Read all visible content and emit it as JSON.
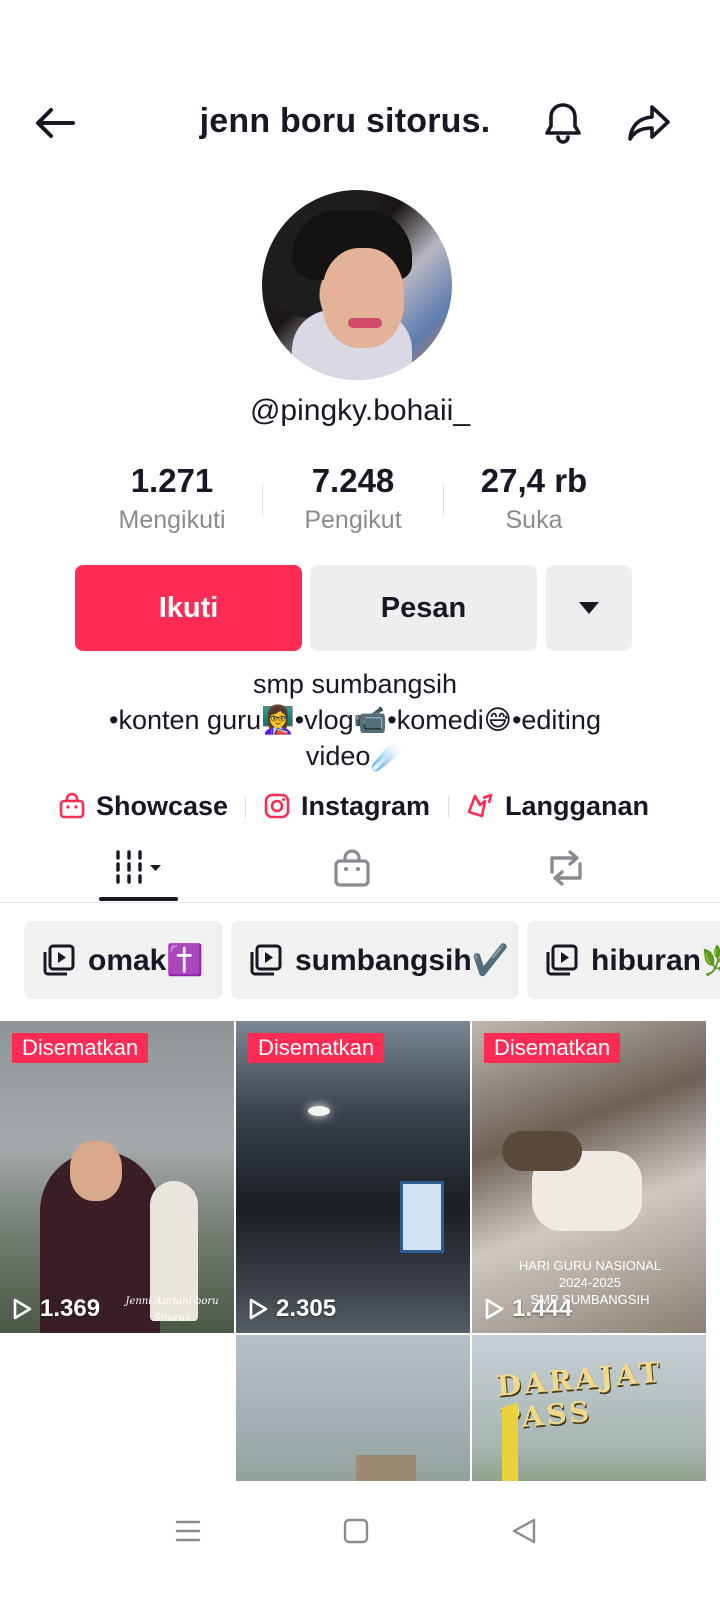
{
  "header": {
    "title": "jenn boru sitorus.",
    "back_icon": "arrow-left-icon",
    "bell_icon": "bell-icon",
    "share_icon": "share-icon"
  },
  "profile": {
    "handle": "@pingky.bohaii_",
    "stats": [
      {
        "value": "1.271",
        "label": "Mengikuti"
      },
      {
        "value": "7.248",
        "label": "Pengikut"
      },
      {
        "value": "27,4 rb",
        "label": "Suka"
      }
    ],
    "follow_label": "Ikuti",
    "message_label": "Pesan",
    "bio_line1": "smp sumbangsih",
    "bio_line2": "•konten guru👩‍🏫•vlog📹•komedi😅•editing",
    "bio_line3": "video☄️",
    "links": [
      {
        "label": "Showcase",
        "icon": "shopping-bag-icon"
      },
      {
        "label": "Instagram",
        "icon": "instagram-icon"
      },
      {
        "label": "Langganan",
        "icon": "subscription-icon"
      }
    ]
  },
  "tabs": [
    {
      "name": "videos",
      "icon": "grid-icon",
      "active": true
    },
    {
      "name": "shop",
      "icon": "shopping-bag-icon",
      "active": false
    },
    {
      "name": "reposts",
      "icon": "repost-icon",
      "active": false
    }
  ],
  "playlists": [
    {
      "label": "omak✝️"
    },
    {
      "label": "sumbangsih✔️"
    },
    {
      "label": "hiburan🌿"
    }
  ],
  "videos": [
    {
      "pinned": "Disematkan",
      "views": "1.369",
      "caption": "Jenni Apriani boru Sitorus"
    },
    {
      "pinned": "Disematkan",
      "views": "2.305",
      "caption": ""
    },
    {
      "pinned": "Disematkan",
      "views": "1.444",
      "caption": "HARI GURU NASIONAL\n2024-2025\nSMP SUMBANGSIH"
    },
    {
      "pinned": "",
      "views": "",
      "caption": ""
    },
    {
      "pinned": "",
      "views": "",
      "caption": ""
    },
    {
      "pinned": "",
      "views": "",
      "caption": "DARAJAT PASS"
    }
  ],
  "colors": {
    "accent": "#fe2c55",
    "text": "#161823",
    "muted": "#8a8b91",
    "button_bg": "#eeeef0"
  }
}
